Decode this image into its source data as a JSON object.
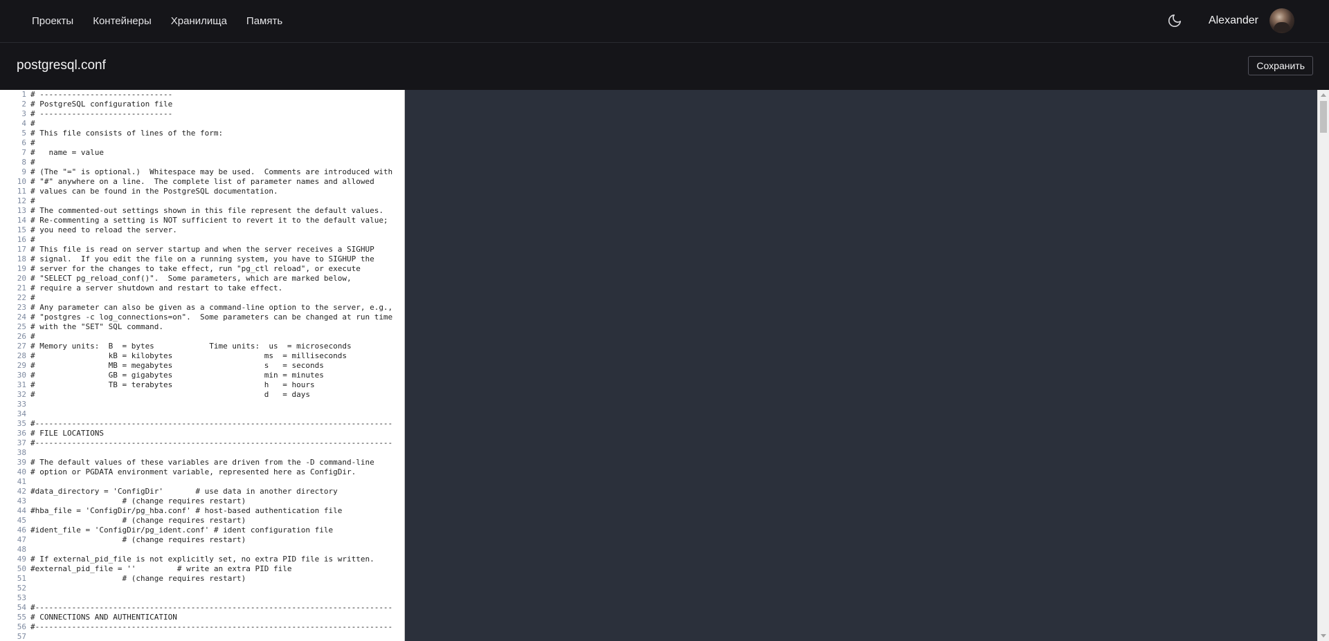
{
  "nav": {
    "items": [
      {
        "label": "Проекты"
      },
      {
        "label": "Контейнеры"
      },
      {
        "label": "Хранилища"
      },
      {
        "label": "Память"
      }
    ]
  },
  "user": {
    "name": "Alexander"
  },
  "header": {
    "title": "postgresql.conf",
    "save_label": "Сохранить"
  },
  "editor": {
    "lines": [
      "# -----------------------------",
      "# PostgreSQL configuration file",
      "# -----------------------------",
      "#",
      "# This file consists of lines of the form:",
      "#",
      "#   name = value",
      "#",
      "# (The \"=\" is optional.)  Whitespace may be used.  Comments are introduced with",
      "# \"#\" anywhere on a line.  The complete list of parameter names and allowed",
      "# values can be found in the PostgreSQL documentation.",
      "#",
      "# The commented-out settings shown in this file represent the default values.",
      "# Re-commenting a setting is NOT sufficient to revert it to the default value;",
      "# you need to reload the server.",
      "#",
      "# This file is read on server startup and when the server receives a SIGHUP",
      "# signal.  If you edit the file on a running system, you have to SIGHUP the",
      "# server for the changes to take effect, run \"pg_ctl reload\", or execute",
      "# \"SELECT pg_reload_conf()\".  Some parameters, which are marked below,",
      "# require a server shutdown and restart to take effect.",
      "#",
      "# Any parameter can also be given as a command-line option to the server, e.g.,",
      "# \"postgres -c log_connections=on\".  Some parameters can be changed at run time",
      "# with the \"SET\" SQL command.",
      "#",
      "# Memory units:  B  = bytes            Time units:  us  = microseconds",
      "#                kB = kilobytes                    ms  = milliseconds",
      "#                MB = megabytes                    s   = seconds",
      "#                GB = gigabytes                    min = minutes",
      "#                TB = terabytes                    h   = hours",
      "#                                                  d   = days",
      "",
      "",
      "#------------------------------------------------------------------------------",
      "# FILE LOCATIONS",
      "#------------------------------------------------------------------------------",
      "",
      "# The default values of these variables are driven from the -D command-line",
      "# option or PGDATA environment variable, represented here as ConfigDir.",
      "",
      "#data_directory = 'ConfigDir'       # use data in another directory",
      "                    # (change requires restart)",
      "#hba_file = 'ConfigDir/pg_hba.conf' # host-based authentication file",
      "                    # (change requires restart)",
      "#ident_file = 'ConfigDir/pg_ident.conf' # ident configuration file",
      "                    # (change requires restart)",
      "",
      "# If external_pid_file is not explicitly set, no extra PID file is written.",
      "#external_pid_file = ''         # write an extra PID file",
      "                    # (change requires restart)",
      "",
      "",
      "#------------------------------------------------------------------------------",
      "# CONNECTIONS AND AUTHENTICATION",
      "#------------------------------------------------------------------------------",
      ""
    ]
  }
}
